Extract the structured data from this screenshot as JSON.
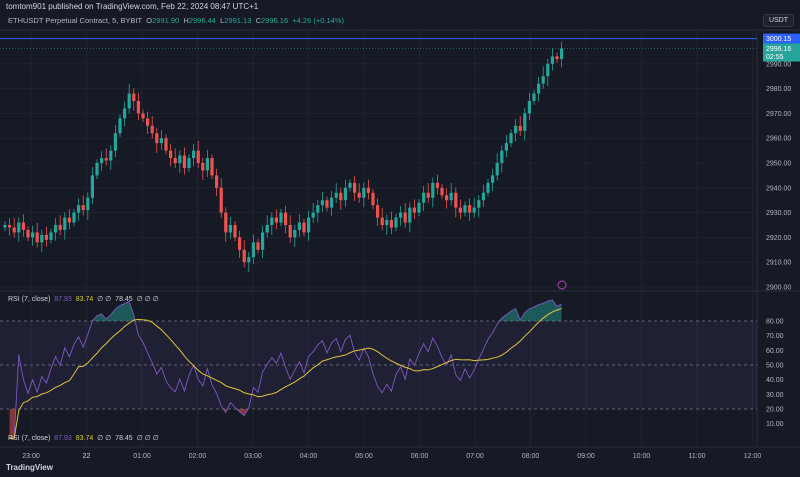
{
  "header": {
    "published": "tomtom901 published on TradingView.com, Feb 22, 2024 08:47 UTC+1",
    "symbol": "ETHUSDT Perpetual Contract, 5, BYBIT",
    "o_label": "O",
    "o": "2991.90",
    "h_label": "H",
    "h": "2996.44",
    "l_label": "L",
    "l": "2991.13",
    "c_label": "C",
    "c": "2996.16",
    "change": "+4.26 (+0.14%)"
  },
  "currency": "USDT",
  "alert_price": "3000.15",
  "last_price": "2996.16",
  "countdown": "02:55",
  "colors": {
    "up": "#26a69a",
    "down": "#ef5350",
    "rsi": "#7e57c2",
    "ma": "#e0c53a",
    "alert": "#2962ff",
    "bg": "#161a25"
  },
  "price_ticks": [
    "2990.00",
    "2980.00",
    "2970.00",
    "2960.00",
    "2950.00",
    "2940.00",
    "2930.00",
    "2920.00",
    "2910.00",
    "2900.00"
  ],
  "rsi": {
    "label": "RSI (7, close)",
    "value": "87.93",
    "ma": "83.74",
    "sym": "∅ ∅",
    "extra": "78.45",
    "sym2": "∅ ∅ ∅",
    "ticks": [
      "80.00",
      "70.00",
      "60.00",
      "50.00",
      "40.00",
      "30.00",
      "20.00",
      "10.00"
    ]
  },
  "time_ticks": [
    "23:00",
    "22",
    "01:00",
    "02:00",
    "03:00",
    "04:00",
    "05:00",
    "06:00",
    "07:00",
    "08:00",
    "09:00",
    "10:00",
    "11:00",
    "12:00"
  ],
  "footer": "TradingView",
  "chart_data": {
    "type": "candlestick",
    "interval": "5m",
    "price_range": [
      2900,
      3000
    ],
    "closes": [
      2925,
      2924,
      2922,
      2926,
      2923,
      2920,
      2922,
      2918,
      2921,
      2919,
      2922,
      2925,
      2923,
      2928,
      2926,
      2930,
      2933,
      2931,
      2936,
      2945,
      2950,
      2952,
      2951,
      2955,
      2962,
      2968,
      2972,
      2978,
      2975,
      2970,
      2968,
      2965,
      2962,
      2958,
      2960,
      2955,
      2952,
      2950,
      2953,
      2948,
      2952,
      2955,
      2950,
      2947,
      2952,
      2945,
      2940,
      2930,
      2922,
      2925,
      2920,
      2915,
      2910,
      2912,
      2918,
      2915,
      2922,
      2925,
      2928,
      2926,
      2930,
      2925,
      2920,
      2923,
      2926,
      2922,
      2928,
      2930,
      2933,
      2935,
      2932,
      2936,
      2938,
      2935,
      2940,
      2942,
      2938,
      2936,
      2940,
      2938,
      2933,
      2928,
      2925,
      2927,
      2924,
      2928,
      2930,
      2926,
      2932,
      2930,
      2934,
      2938,
      2936,
      2942,
      2940,
      2937,
      2935,
      2938,
      2932,
      2930,
      2933,
      2930,
      2932,
      2935,
      2938,
      2942,
      2945,
      2950,
      2955,
      2958,
      2962,
      2965,
      2963,
      2970,
      2975,
      2978,
      2982,
      2985,
      2990,
      2993,
      2991.9,
      2996.16
    ]
  }
}
